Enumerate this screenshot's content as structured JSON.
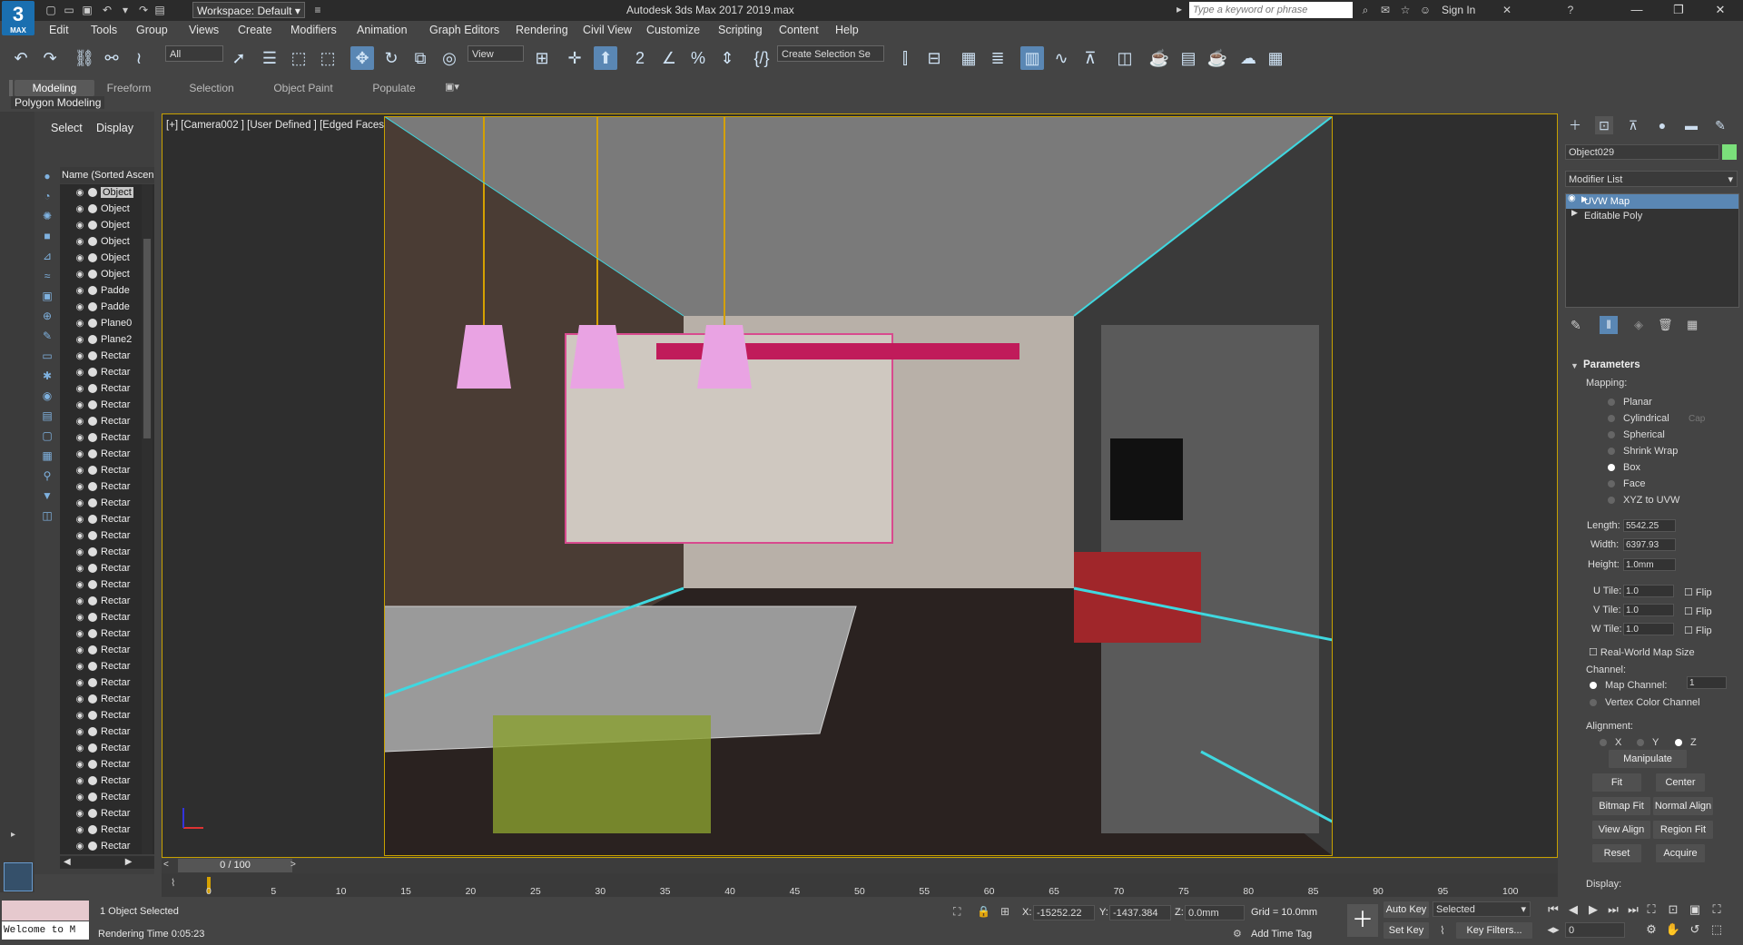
{
  "app": {
    "logo_text": "3",
    "logo_sub": "MAX",
    "title": "Autodesk 3ds Max 2017    2019.max",
    "workspace": "Workspace: Default",
    "search_placeholder": "Type a keyword or phrase",
    "sign_in": "Sign In"
  },
  "menu": [
    "Edit",
    "Tools",
    "Group",
    "Views",
    "Create",
    "Modifiers",
    "Animation",
    "Graph Editors",
    "Rendering",
    "Civil View",
    "Customize",
    "Scripting",
    "Content",
    "Help"
  ],
  "toolbar": {
    "selection_filter": "All",
    "ref_coord": "View",
    "named_selection": "Create Selection Se"
  },
  "ribbon": {
    "tabs": [
      "Modeling",
      "Freeform",
      "Selection",
      "Object Paint",
      "Populate"
    ],
    "subtitle": "Polygon Modeling"
  },
  "explorer": {
    "tab_select": "Select",
    "tab_display": "Display",
    "column_header": "Name (Sorted Ascen",
    "items": [
      "Object",
      "Object",
      "Object",
      "Object",
      "Object",
      "Object",
      "Padde",
      "Padde",
      "Plane0",
      "Plane2",
      "Rectar",
      "Rectar",
      "Rectar",
      "Rectar",
      "Rectar",
      "Rectar",
      "Rectar",
      "Rectar",
      "Rectar",
      "Rectar",
      "Rectar",
      "Rectar",
      "Rectar",
      "Rectar",
      "Rectar",
      "Rectar",
      "Rectar",
      "Rectar",
      "Rectar",
      "Rectar",
      "Rectar",
      "Rectar",
      "Rectar",
      "Rectar",
      "Rectar",
      "Rectar",
      "Rectar",
      "Rectar",
      "Rectar",
      "Rectar",
      "Rectar"
    ]
  },
  "viewport": {
    "label": "[+] [Camera002 ] [User Defined ] [Edged Faces ]"
  },
  "command_panel": {
    "object_name": "Object029",
    "object_color": "#7be07b",
    "modifier_list": "Modifier List",
    "stack": [
      "UVW Map",
      "Editable Poly"
    ],
    "parameters": "Parameters",
    "mapping_label": "Mapping:",
    "mapping_options": [
      "Planar",
      "Cylindrical",
      "Spherical",
      "Shrink Wrap",
      "Box",
      "Face",
      "XYZ to UVW"
    ],
    "mapping_selected": "Box",
    "cap": "Cap",
    "length_label": "Length:",
    "length": "5542.25",
    "width_label": "Width:",
    "width": "6397.93",
    "height_label": "Height:",
    "height": "1.0mm",
    "u_tile_label": "U Tile:",
    "u_tile": "1.0",
    "v_tile_label": "V Tile:",
    "v_tile": "1.0",
    "w_tile_label": "W Tile:",
    "w_tile": "1.0",
    "flip": "Flip",
    "real_world": "Real-World Map Size",
    "channel_label": "Channel:",
    "map_channel": "Map Channel:",
    "map_channel_value": "1",
    "vertex_color": "Vertex Color Channel",
    "alignment_label": "Alignment:",
    "axes": [
      "X",
      "Y",
      "Z"
    ],
    "axis_selected": "Z",
    "buttons": [
      "Manipulate",
      "Fit",
      "Center",
      "Bitmap Fit",
      "Normal Align",
      "View Align",
      "Region Fit",
      "Reset",
      "Acquire"
    ],
    "display_label": "Display:"
  },
  "timeline": {
    "frame": "0 / 100",
    "ticks": [
      "0",
      "5",
      "10",
      "15",
      "20",
      "25",
      "30",
      "35",
      "40",
      "45",
      "50",
      "55",
      "60",
      "65",
      "70",
      "75",
      "80",
      "85",
      "90",
      "95",
      "100"
    ]
  },
  "status": {
    "objects_selected": "1 Object Selected",
    "rendering_time": "Rendering Time  0:05:23",
    "maxscript": "Welcome to M",
    "x_label": "X:",
    "x": "-15252.22",
    "y_label": "Y:",
    "y": "-1437.384",
    "z_label": "Z:",
    "z": "0.0mm",
    "grid": "Grid = 10.0mm",
    "add_time_tag": "Add Time Tag",
    "auto_key": "Auto Key",
    "set_key": "Set Key",
    "selected": "Selected",
    "key_filters": "Key Filters...",
    "frame_input": "0"
  }
}
